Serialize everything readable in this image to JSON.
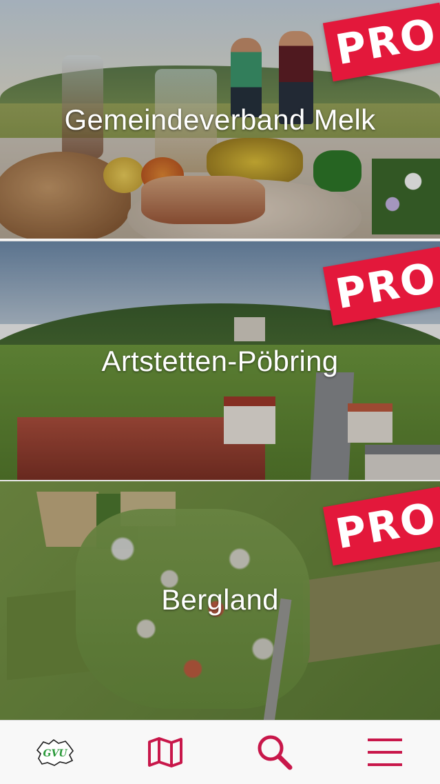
{
  "colors": {
    "accent": "#c8174a",
    "pro_badge": "#e3183b",
    "tab_bar_bg": "#f8f8f8"
  },
  "cards": [
    {
      "title": "Gemeindeverband Melk",
      "badge": "PRO"
    },
    {
      "title": "Artstetten-Pöbring",
      "badge": "PRO"
    },
    {
      "title": "Bergland",
      "badge": "PRO"
    }
  ],
  "tab_bar": {
    "items": [
      {
        "icon": "gvu-logo-icon",
        "logo_text": "GVU"
      },
      {
        "icon": "map-icon"
      },
      {
        "icon": "search-icon"
      },
      {
        "icon": "hamburger-menu-icon"
      }
    ]
  }
}
